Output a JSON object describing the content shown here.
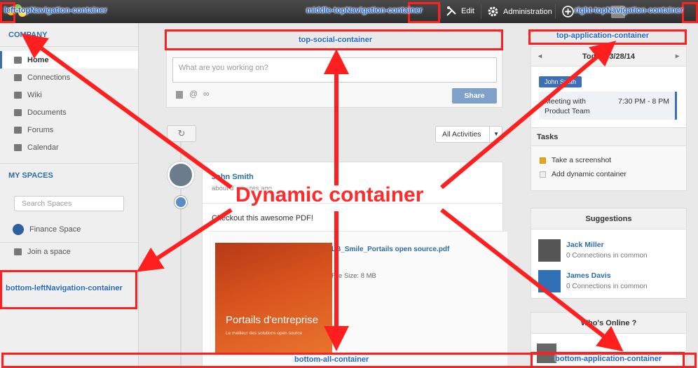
{
  "topbar": {
    "edit_label": "Edit",
    "admin_label": "Administration"
  },
  "leftnav": {
    "company_heading": "COMPANY",
    "items": [
      {
        "label": "Home",
        "icon": "home-icon"
      },
      {
        "label": "Connections",
        "icon": "person-icon"
      },
      {
        "label": "Wiki",
        "icon": "book-icon"
      },
      {
        "label": "Documents",
        "icon": "documents-icon"
      },
      {
        "label": "Forums",
        "icon": "forum-icon"
      },
      {
        "label": "Calendar",
        "icon": "calendar-icon"
      }
    ],
    "spaces_heading": "MY SPACES",
    "search_placeholder": "Search Spaces",
    "space_name": "Finance Space",
    "join_label": "Join a space"
  },
  "composer": {
    "placeholder": "What are you working on?",
    "share_label": "Share"
  },
  "stream": {
    "filter_label": "All Activities",
    "post": {
      "author": "John Smith",
      "time": "about 3 minutes ago",
      "text": "Checkout this awesome PDF!",
      "file_name": "LB_Smile_Portails open source.pdf",
      "file_size": "File Size:  8 MB",
      "thumb_title": "Portails d'entreprise",
      "thumb_subtitle": "Le meilleur des solutions open source"
    }
  },
  "calendar": {
    "date_label": "Today: 3/28/14",
    "user_tag": "John Smith",
    "event_title_line1": "Meeting with",
    "event_title_line2": "Product Team",
    "event_time": "7:30 PM - 8 PM"
  },
  "tasks": {
    "heading": "Tasks",
    "items": [
      "Take a screenshot",
      "Add dynamic container"
    ]
  },
  "suggestions": {
    "heading": "Suggestions",
    "people": [
      {
        "name": "Jack Miller",
        "meta": "0 Connections in common"
      },
      {
        "name": "James Davis",
        "meta": "0 Connections in common"
      }
    ]
  },
  "online": {
    "heading": "Who's Online ?"
  },
  "annotations": {
    "left_top_nav": "left-topNavigation-container",
    "middle_top_nav": "middle-topNavigation-container",
    "right_top_nav": "right-topNavigation-container",
    "top_social": "top-social-container",
    "top_application": "top-application-container",
    "bottom_left_nav": "bottom-leftNavigation-container",
    "bottom_all": "bottom-all-container",
    "bottom_application": "bottom-application-container",
    "dynamic": "Dynamic container"
  },
  "colors": {
    "annotation_red": "#ff1f1f",
    "annotation_blue": "#1e63d6",
    "link_blue": "#2c6ea5"
  }
}
